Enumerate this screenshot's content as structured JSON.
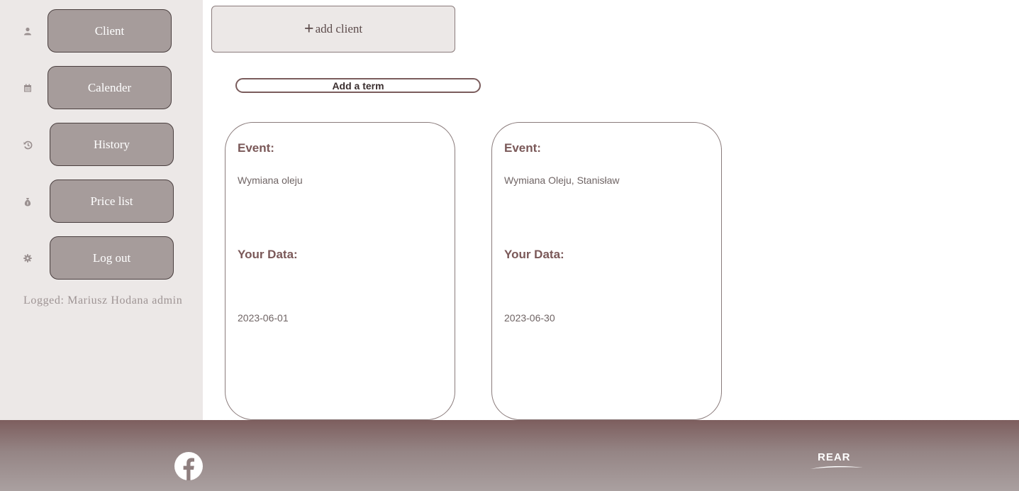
{
  "sidebar": {
    "items": [
      {
        "label": "Client",
        "icon": "user-icon"
      },
      {
        "label": "Calender",
        "icon": "calendar-icon"
      },
      {
        "label": "History",
        "icon": "history-icon"
      },
      {
        "label": "Price list",
        "icon": "money-bag-icon"
      },
      {
        "label": "Log out",
        "icon": "gear-icon"
      }
    ],
    "logged_text": "Logged: Mariusz Hodana admin"
  },
  "main": {
    "add_client_label": "add client",
    "add_term_label": "Add a term",
    "cards": [
      {
        "event_label": "Event:",
        "event_value": "Wymiana oleju",
        "data_label": "Your Data:",
        "date": "2023-06-01"
      },
      {
        "event_label": "Event:",
        "event_value": "Wymiana Oleju, Stanisław",
        "data_label": "Your Data:",
        "date": "2023-06-30"
      }
    ]
  },
  "footer": {
    "social_icon": "facebook-icon",
    "brand": "REAR"
  },
  "colors": {
    "sidebar_bg": "#ece8e7",
    "nav_button": "#a69c9b",
    "accent": "#7a5858",
    "footer_top": "#7d5e5e",
    "footer_bottom": "#aaa0a0"
  }
}
